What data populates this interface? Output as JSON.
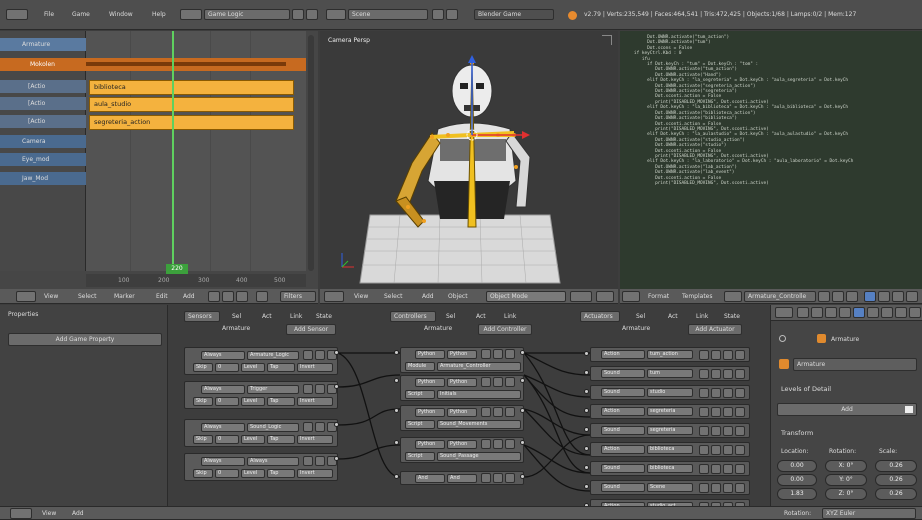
{
  "topbar": {
    "menu": [
      "File",
      "Game",
      "Window",
      "Help"
    ],
    "screen_layout": "Game Logic",
    "scene": "Scene",
    "engine": "Blender Game",
    "stats": "v2.79 | Verts:235,549 | Faces:464,541 | Tris:472,425 | Objects:1/68 | Lamps:0/2 | Mem:127"
  },
  "nla": {
    "tracks": [
      {
        "label": "Armature",
        "kind": "object"
      },
      {
        "label": "Mokolen",
        "kind": "action"
      },
      {
        "label": "[Actio",
        "kind": "track"
      },
      {
        "label": "[Actio",
        "kind": "track"
      },
      {
        "label": "[Actio",
        "kind": "track"
      },
      {
        "label": "Camera",
        "kind": "object"
      },
      {
        "label": "Eye_mod",
        "kind": "object"
      },
      {
        "label": "Jaw_Mod",
        "kind": "object"
      }
    ],
    "strips": [
      "biblioteca",
      "aula_studio",
      "segreteria_action"
    ],
    "current_frame": "220",
    "ruler": [
      "100",
      "200",
      "300",
      "400",
      "500"
    ],
    "header": {
      "items": [
        "View",
        "Select",
        "Marker",
        "Edit",
        "Add"
      ],
      "filters": "Filters"
    }
  },
  "viewport": {
    "label": "Camera Persp",
    "footer": {
      "items": [
        "View",
        "Select",
        "Add",
        "Object"
      ],
      "mode": "Object Mode"
    }
  },
  "text_editor": {
    "footer": {
      "items": [
        "Format",
        "Templates"
      ],
      "file": "Armature_Controlle"
    },
    "lines": [
      "        Dot.OWNR.activate(\"tum_action\")",
      "        Dot.OWNR.activate(\"tum\")",
      "        Dot.scons = False",
      "",
      "   if keyCtrl.Kbd : 0",
      "      ifu",
      "",
      "        if Dot.keyCh : \"tum\" = Dot.keyCh : \"tom\" :",
      "",
      "           Dot.OWNR.activate(\"tum_action\")",
      "           Dot.OWNR.activate(\"Hand\")",
      "        elif Dot.keyCh : \"la_segreteria\" = Dot.keyCh : \"aula_segreteria\" = Dot.keyCh",
      "           Dot.OWNR.activate(\"segreteria_action\")",
      "           Dot.OWNR.activate(\"segreteria\")",
      "           Dot.sconti.action = False",
      "           print(\"DISABLED_MOVING\", Dot.sconti.active)",
      "",
      "        elif Dot.keyCh : \"la_biblioteca\" = Dot.keyCh : \"aula_biblioteca\" = Dot.keyCh",
      "           Dot.OWNR.activate(\"biblioteca_action\")",
      "           Dot.OWNR.activate(\"biblioteca\")",
      "           Dot.sconti.action = False",
      "           print(\"DISABLED_MOVING\", Dot.sconti.active)",
      "",
      "        elif Dot.keyCh : \"la_aulastudio\" = Dot.keyCh : \"aula_aulastudio\" = Dot.keyCh",
      "           Dot.OWNR.activate(\"studio_action\")",
      "           Dot.OWNR.activate(\"studio\")",
      "           Dot.sconti.action = False",
      "           print(\"DISABLED_MOVING\", Dot.sconti.active)",
      "",
      "        elif Dot.keyCh : \"la_laboratorio\" = Dot.keyCh : \"aula_laboratorio\" = Dot.keyCh",
      "           Dot.OWNR.activate(\"lab_action\")",
      "           Dot.OWNR.activate(\"lab_event\")",
      "           Dot.sconti.action = False",
      "           print(\"DISABLED_MOVING\", Dot.sconti.active)"
    ]
  },
  "properties": {
    "title": "Properties",
    "add_game_property": "Add Game Property"
  },
  "logic": {
    "sensors": {
      "title": "Sensors",
      "object": "Armature",
      "add": "Add Sensor",
      "filters": [
        "Sel",
        "Act",
        "Link",
        "State"
      ],
      "bricks": [
        {
          "type": "Always",
          "name": "Armature_Logic",
          "line2": [
            "Skip",
            "0",
            "Level",
            "Tap",
            "Invert"
          ]
        },
        {
          "type": "Always",
          "name": "Trigger",
          "line2": [
            "Skip",
            "0",
            "Level",
            "Tap",
            "Invert"
          ]
        },
        {
          "type": "Always",
          "name": "Sound_Logic",
          "line2": [
            "Skip",
            "0",
            "Level",
            "Tap",
            "Invert"
          ]
        },
        {
          "type": "Always",
          "name": "Always",
          "line2": [
            "Skip",
            "0",
            "Level",
            "Tap",
            "Invert"
          ]
        }
      ]
    },
    "controllers": {
      "title": "Controllers",
      "object": "Armature",
      "add": "Add Controller",
      "filters": [
        "Sel",
        "Act",
        "Link"
      ],
      "bricks": [
        {
          "type": "Python",
          "name": "Python",
          "line2": [
            "Module",
            "Armature_Controller"
          ]
        },
        {
          "type": "Python",
          "name": "Python",
          "line2": [
            "Script",
            "Initials"
          ]
        },
        {
          "type": "Python",
          "name": "Python",
          "line2": [
            "Script",
            "Sound_Movements"
          ]
        },
        {
          "type": "Python",
          "name": "Python",
          "line2": [
            "Script",
            "Sound_Passage"
          ]
        },
        {
          "type": "And",
          "name": "And",
          "line2": []
        }
      ]
    },
    "actuators": {
      "title": "Actuators",
      "object": "Armature",
      "add": "Add Actuator",
      "filters": [
        "Sel",
        "Act",
        "Link",
        "State"
      ],
      "bricks": [
        {
          "type": "Action",
          "name": "tum_action"
        },
        {
          "type": "Sound",
          "name": "tum"
        },
        {
          "type": "Sound",
          "name": "studio"
        },
        {
          "type": "Action",
          "name": "segreteria"
        },
        {
          "type": "Sound",
          "name": "segreteria"
        },
        {
          "type": "Action",
          "name": "biblioteca"
        },
        {
          "type": "Sound",
          "name": "biblioteca"
        },
        {
          "type": "Sound",
          "name": "Scene"
        },
        {
          "type": "Action",
          "name": "studio_act"
        }
      ]
    }
  },
  "prop_panel": {
    "breadcrumb": "Armature",
    "object_name": "Armature",
    "levels_of_detail": "Levels of Detail",
    "add": "Add",
    "transform": "Transform",
    "headers": [
      "Location:",
      "Rotation:",
      "Scale:"
    ],
    "location": [
      "0.00",
      "0.00",
      "1.83"
    ],
    "rotation": [
      "X: 0°",
      "Y: 0°",
      "Z: 0°"
    ],
    "scale": [
      "0.26",
      "0.26",
      "0.26"
    ],
    "rotation_mode_label": "Rotation:",
    "rotation_mode": "XYZ Euler"
  },
  "bottombar": {
    "items": [
      "View",
      "Add"
    ]
  }
}
